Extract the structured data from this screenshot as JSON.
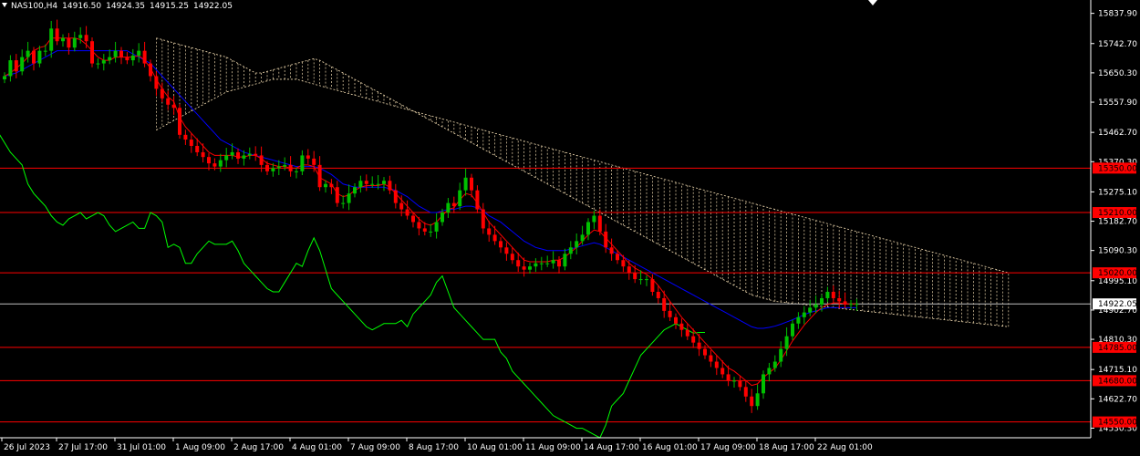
{
  "header": {
    "symbol": "NAS100,H4",
    "open": "14916.50",
    "high": "14924.35",
    "low": "14915.25",
    "close": "14922.05"
  },
  "colors": {
    "background": "#000000",
    "axis": "#ffffff",
    "bull": "#00c000",
    "bear": "#ff0000",
    "tenkan": "#ff0000",
    "kijun": "#0000ff",
    "chikou": "#00ff00",
    "kumo": "#f5deb3",
    "hline": "#ff0000",
    "bid": "#c0c0c0"
  },
  "chart_data": {
    "type": "candlestick",
    "y_axis_ticks": [
      "15837.90",
      "15742.70",
      "15650.30",
      "15557.90",
      "15462.70",
      "15370.30",
      "15275.10",
      "15182.70",
      "15090.30",
      "14995.10",
      "14902.70",
      "14810.30",
      "14715.10",
      "14622.70",
      "14530.30"
    ],
    "x_axis_labels": [
      "26 Jul 2023",
      "27 Jul 17:00",
      "31 Jul 01:00",
      "1 Aug 09:00",
      "2 Aug 17:00",
      "4 Aug 01:00",
      "7 Aug 09:00",
      "8 Aug 17:00",
      "10 Aug 01:00",
      "11 Aug 09:00",
      "14 Aug 17:00",
      "16 Aug 01:00",
      "17 Aug 09:00",
      "18 Aug 17:00",
      "22 Aug 01:00"
    ],
    "horizontal_levels": [
      {
        "label": "15350.00",
        "price": 15350
      },
      {
        "label": "15210.00",
        "price": 15210
      },
      {
        "label": "15020.00",
        "price": 15020
      },
      {
        "label": "14785.00",
        "price": 14785
      },
      {
        "label": "14680.00",
        "price": 14680
      },
      {
        "label": "14550.00",
        "price": 14550
      }
    ],
    "current_price": "14922.05",
    "current_price_value": 14922.05,
    "ylim": [
      14500,
      15880
    ],
    "bar_count": 147,
    "close": [
      15640,
      15690,
      15655,
      15700,
      15720,
      15680,
      15720,
      15720,
      15790,
      15750,
      15760,
      15730,
      15760,
      15770,
      15750,
      15680,
      15680,
      15690,
      15700,
      15720,
      15700,
      15690,
      15705,
      15720,
      15680,
      15640,
      15600,
      15570,
      15550,
      15540,
      15455,
      15440,
      15420,
      15400,
      15385,
      15365,
      15355,
      15375,
      15390,
      15400,
      15380,
      15390,
      15395,
      15390,
      15360,
      15340,
      15350,
      15355,
      15360,
      15340,
      15340,
      15390,
      15380,
      15360,
      15290,
      15300,
      15290,
      15240,
      15240,
      15270,
      15290,
      15310,
      15300,
      15300,
      15300,
      15310,
      15280,
      15240,
      15220,
      15200,
      15180,
      15160,
      15150,
      15150,
      15180,
      15210,
      15240,
      15230,
      15280,
      15320,
      15280,
      15220,
      15160,
      15140,
      15120,
      15100,
      15080,
      15060,
      15040,
      15030,
      15040,
      15050,
      15050,
      15050,
      15060,
      15040,
      15080,
      15100,
      15120,
      15140,
      15180,
      15200,
      15150,
      15100,
      15080,
      15060,
      15040,
      15020,
      15000,
      15000,
      15000,
      14960,
      14940,
      14900,
      14880,
      14860,
      14840,
      14820,
      14800,
      14780,
      14760,
      14740,
      14720,
      14700,
      14680,
      14680,
      14660,
      14630,
      14600,
      14640,
      14700,
      14720,
      14740,
      14780,
      14820,
      14860,
      14880,
      14895,
      14910,
      14920,
      14940,
      14960,
      14940,
      14930,
      14920,
      14922,
      14922
    ],
    "series": [
      {
        "name": "tenkan",
        "values": [
          15640,
          15650,
          15665,
          15680,
          15700,
          15720,
          15730,
          15735,
          15760,
          15760,
          15760,
          15760,
          15760,
          15755,
          15740,
          15720,
          15700,
          15690,
          15690,
          15700,
          15700,
          15700,
          15700,
          15705,
          15690,
          15665,
          15630,
          15600,
          15575,
          15560,
          15510,
          15480,
          15460,
          15440,
          15420,
          15400,
          15390,
          15390,
          15390,
          15390,
          15385,
          15385,
          15390,
          15390,
          15380,
          15365,
          15360,
          15355,
          15355,
          15350,
          15350,
          15360,
          15360,
          15355,
          15320,
          15310,
          15300,
          15270,
          15260,
          15265,
          15280,
          15290,
          15295,
          15295,
          15295,
          15300,
          15290,
          15270,
          15250,
          15230,
          15210,
          15190,
          15175,
          15170,
          15180,
          15200,
          15220,
          15225,
          15250,
          15270,
          15265,
          15240,
          15210,
          15180,
          15160,
          15140,
          15120,
          15100,
          15080,
          15060,
          15055,
          15055,
          15055,
          15055,
          15060,
          15060,
          15070,
          15085,
          15100,
          15120,
          15140,
          15155,
          15150,
          15130,
          15110,
          15090,
          15070,
          15050,
          15035,
          15025,
          15015,
          15000,
          14980,
          14955,
          14930,
          14905,
          14880,
          14860,
          14840,
          14820,
          14800,
          14780,
          14760,
          14740,
          14720,
          14710,
          14695,
          14680,
          14665,
          14670,
          14690,
          14705,
          14720,
          14745,
          14775,
          14805,
          14830,
          14855,
          14875,
          14895,
          14910,
          14920,
          14925,
          14925,
          14922,
          14922,
          14922
        ]
      },
      {
        "name": "kijun",
        "values": [
          15640,
          15645,
          15650,
          15660,
          15670,
          15680,
          15690,
          15700,
          15710,
          15720,
          15720,
          15720,
          15720,
          15720,
          15720,
          15720,
          15720,
          15720,
          15720,
          15720,
          15720,
          15720,
          15710,
          15700,
          15690,
          15680,
          15660,
          15640,
          15620,
          15600,
          15580,
          15560,
          15540,
          15520,
          15500,
          15480,
          15460,
          15440,
          15430,
          15420,
          15410,
          15400,
          15395,
          15390,
          15385,
          15380,
          15375,
          15370,
          15365,
          15360,
          15355,
          15355,
          15355,
          15355,
          15350,
          15340,
          15330,
          15315,
          15300,
          15295,
          15290,
          15290,
          15290,
          15290,
          15290,
          15290,
          15285,
          15280,
          15270,
          15260,
          15245,
          15230,
          15220,
          15210,
          15210,
          15215,
          15220,
          15220,
          15225,
          15230,
          15230,
          15225,
          15215,
          15200,
          15190,
          15180,
          15165,
          15150,
          15135,
          15120,
          15110,
          15100,
          15095,
          15090,
          15090,
          15090,
          15090,
          15095,
          15100,
          15105,
          15110,
          15115,
          15110,
          15100,
          15090,
          15080,
          15070,
          15060,
          15050,
          15040,
          15030,
          15020,
          15010,
          15000,
          14990,
          14980,
          14970,
          14960,
          14950,
          14940,
          14930,
          14920,
          14910,
          14900,
          14890,
          14880,
          14870,
          14860,
          14850,
          14845,
          14845,
          14848,
          14852,
          14858,
          14865,
          14872,
          14880,
          14888,
          14895,
          14900,
          14905,
          14910,
          14910,
          14910,
          14910,
          14910,
          14910
        ]
      }
    ],
    "chikou_values": [
      15510,
      15540,
      15520,
      15570,
      15560,
      15530,
      15550,
      15560,
      15590,
      15570,
      15580,
      15550,
      15580,
      15590,
      15570,
      15520,
      15510,
      15500,
      15520,
      15540,
      15520,
      15510,
      15530,
      15540,
      15500,
      15460,
      15430,
      15400,
      15380,
      15360,
      15300,
      15270,
      15250,
      15230,
      15200,
      15180,
      15170,
      15190,
      15200,
      15210,
      15190,
      15200,
      15210,
      15200,
      15170,
      15150,
      15160,
      15170,
      15180,
      15160,
      15160,
      15210,
      15200,
      15180,
      15100,
      15110,
      15100,
      15050,
      15050,
      15080,
      15100,
      15120,
      15110,
      15110,
      15110,
      15120,
      15090,
      15050,
      15030,
      15010,
      14990,
      14970,
      14960,
      14960,
      14990,
      15020,
      15050,
      15040,
      15090,
      15130,
      15090,
      15030,
      14970,
      14950,
      14930,
      14910,
      14890,
      14870,
      14850,
      14840,
      14850,
      14860,
      14860,
      14860,
      14870,
      14850,
      14890,
      14910,
      14930,
      14950,
      14990,
      15010,
      14960,
      14910,
      14890,
      14870,
      14850,
      14830,
      14810,
      14810,
      14810,
      14770,
      14750,
      14710,
      14690,
      14670,
      14650,
      14630,
      14610,
      14590,
      14570,
      14560,
      14550,
      14540,
      14530,
      14530,
      14520,
      14510,
      14500,
      14540,
      14600,
      14620,
      14640,
      14680,
      14720,
      14760,
      14780,
      14800,
      14820,
      14840,
      14850,
      14860,
      14850,
      14840,
      14830,
      14832,
      14832
    ],
    "kumo_upper": [
      15760,
      15755,
      15750,
      15745,
      15740,
      15735,
      15730,
      15725,
      15720,
      15715,
      15710,
      15705,
      15700,
      15690,
      15680,
      15670,
      15660,
      15650,
      15650,
      15655,
      15660,
      15665,
      15670,
      15675,
      15680,
      15685,
      15690,
      15695,
      15690,
      15680,
      15670,
      15660,
      15650,
      15640,
      15630,
      15620,
      15610,
      15600,
      15590,
      15580,
      15570,
      15560,
      15550,
      15540,
      15530,
      15520,
      15510,
      15500,
      15490,
      15480,
      15470,
      15460,
      15450,
      15440,
      15430,
      15420,
      15410,
      15400,
      15390,
      15380,
      15370,
      15360,
      15350,
      15340,
      15330,
      15320,
      15310,
      15300,
      15290,
      15280,
      15270,
      15260,
      15250,
      15240,
      15230,
      15220,
      15210,
      15200,
      15190,
      15180,
      15170,
      15160,
      15150,
      15140,
      15130,
      15120,
      15110,
      15100,
      15090,
      15080,
      15070,
      15060,
      15050,
      15040,
      15030,
      15020,
      15010,
      15000,
      14990,
      14980,
      14970,
      14960,
      14950,
      14945,
      14940,
      14935,
      14930,
      14928,
      14926,
      14924,
      14922,
      14920,
      14918,
      14916,
      14914,
      14912,
      14910,
      14908,
      14906,
      14904,
      14902,
      14900,
      14898,
      14896,
      14894,
      14892,
      14890,
      14888,
      14886,
      14884,
      14882,
      14880,
      14878,
      14876,
      14874,
      14872,
      14870,
      14868,
      14866,
      14864,
      14862,
      14860,
      14858,
      14856,
      14854,
      14852,
      14850
    ],
    "kumo_lower": [
      15470,
      15480,
      15490,
      15500,
      15510,
      15520,
      15530,
      15540,
      15550,
      15560,
      15570,
      15580,
      15590,
      15595,
      15600,
      15605,
      15610,
      15615,
      15620,
      15625,
      15630,
      15630,
      15630,
      15630,
      15630,
      15625,
      15620,
      15615,
      15610,
      15605,
      15600,
      15595,
      15590,
      15585,
      15580,
      15575,
      15570,
      15565,
      15560,
      15555,
      15550,
      15545,
      15540,
      15535,
      15530,
      15525,
      15520,
      15515,
      15510,
      15505,
      15500,
      15495,
      15490,
      15485,
      15480,
      15475,
      15470,
      15465,
      15460,
      15455,
      15450,
      15445,
      15440,
      15435,
      15430,
      15425,
      15420,
      15415,
      15410,
      15405,
      15400,
      15395,
      15390,
      15385,
      15380,
      15375,
      15370,
      15365,
      15360,
      15355,
      15350,
      15345,
      15340,
      15335,
      15330,
      15325,
      15320,
      15315,
      15310,
      15305,
      15300,
      15295,
      15290,
      15285,
      15280,
      15275,
      15270,
      15265,
      15260,
      15255,
      15250,
      15245,
      15240,
      15235,
      15230,
      15225,
      15220,
      15215,
      15210,
      15205,
      15200,
      15195,
      15190,
      15185,
      15180,
      15175,
      15170,
      15165,
      15160,
      15155,
      15150,
      15145,
      15140,
      15135,
      15130,
      15125,
      15120,
      15115,
      15110,
      15105,
      15100,
      15095,
      15090,
      15085,
      15080,
      15075,
      15070,
      15065,
      15060,
      15055,
      15050,
      15045,
      15040,
      15035,
      15030,
      15025,
      15020
    ]
  }
}
